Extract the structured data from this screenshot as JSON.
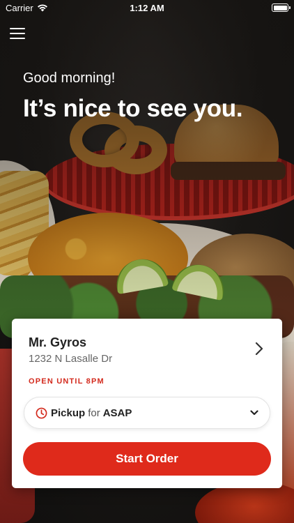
{
  "status_bar": {
    "carrier": "Carrier",
    "time": "1:12 AM",
    "icons": [
      "wifi-icon",
      "battery-icon"
    ]
  },
  "header": {
    "menu_icon": "hamburger-menu-icon",
    "greeting": "Good morning!",
    "headline": "It’s nice to see you."
  },
  "store": {
    "name": "Mr. Gyros",
    "address": "1232 N Lasalle Dr",
    "hours_status": "OPEN UNTIL 8PM"
  },
  "order_mode": {
    "mode": "Pickup",
    "for_label": "for",
    "time": "ASAP",
    "icon": "clock-icon"
  },
  "actions": {
    "start_order_label": "Start Order"
  },
  "colors": {
    "accent": "#df2a1b",
    "status_text": "#d32a1d",
    "card_bg": "#ffffff"
  }
}
